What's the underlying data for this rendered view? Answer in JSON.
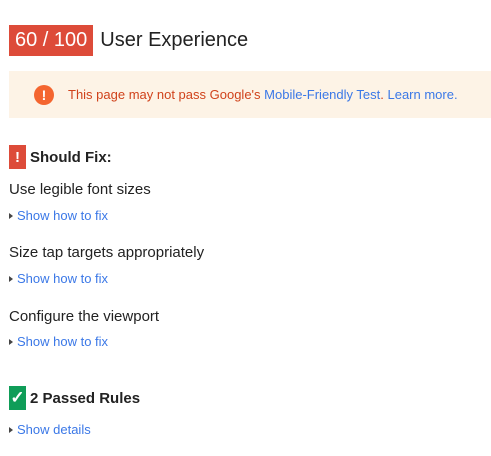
{
  "header": {
    "score": "60 / 100",
    "title": "User Experience"
  },
  "warning": {
    "icon": "exclamation-circle-icon",
    "prefix": "This page may not pass Google's ",
    "link_test": "Mobile-Friendly Test",
    "separator": ". ",
    "link_learn": "Learn more."
  },
  "should_fix": {
    "badge": "!",
    "label": "Should Fix:",
    "rules": [
      {
        "title": "Use legible font sizes",
        "toggle": "Show how to fix"
      },
      {
        "title": "Size tap targets appropriately",
        "toggle": "Show how to fix"
      },
      {
        "title": "Configure the viewport",
        "toggle": "Show how to fix"
      }
    ]
  },
  "passed": {
    "badge": "✓",
    "label": "2 Passed Rules",
    "toggle": "Show details"
  },
  "colors": {
    "score_badge": "#dd4b39",
    "warning_bg": "#fdf3e6",
    "warning_text": "#d0421b",
    "link": "#3b78e7",
    "pass_badge": "#0f9d58"
  }
}
